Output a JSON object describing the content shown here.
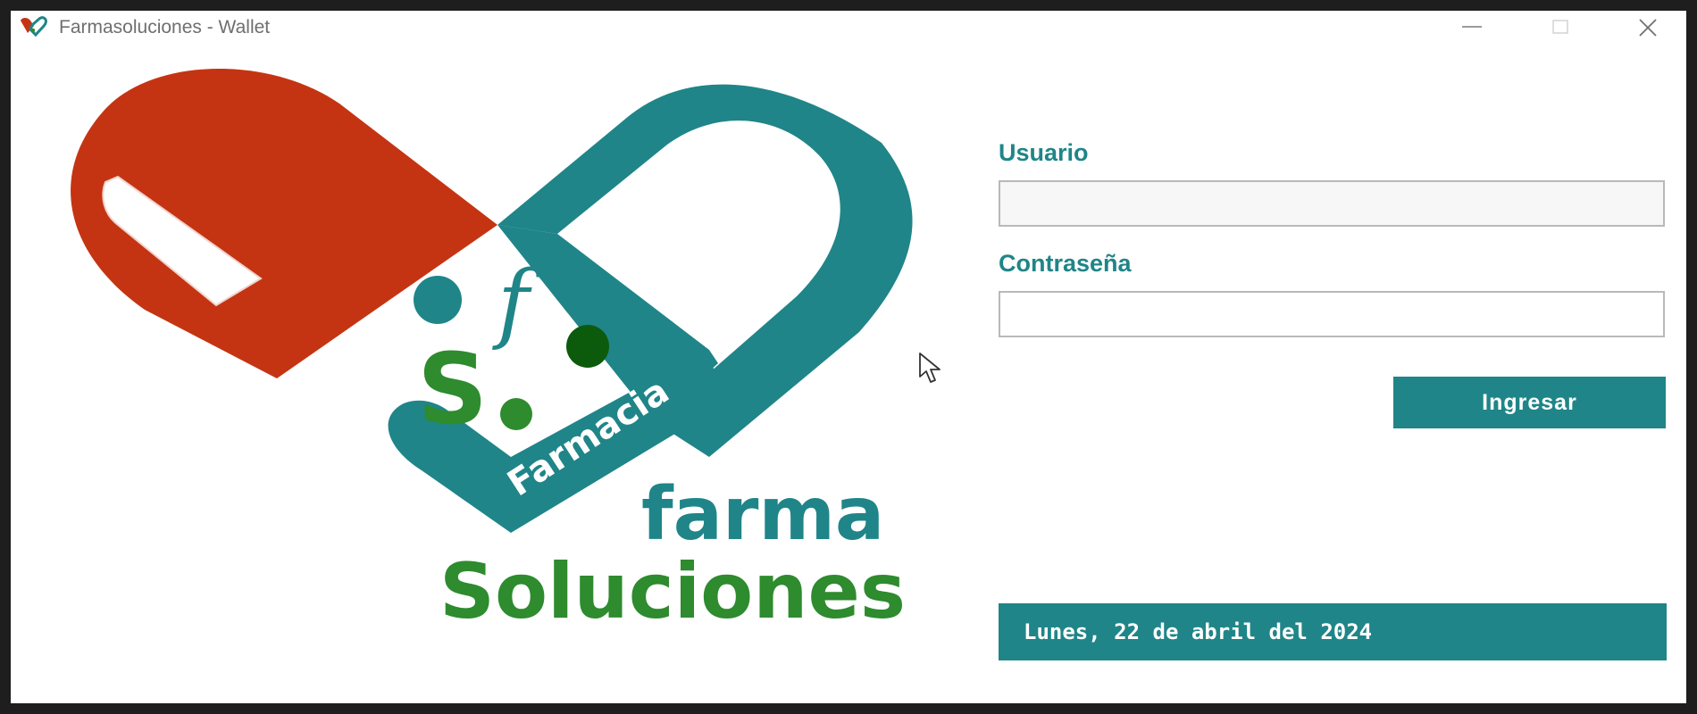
{
  "window": {
    "title": "Farmasoluciones - Wallet"
  },
  "logo": {
    "circle_text": "Farmacia",
    "brand_line1": "farma",
    "brand_line2": "Soluciones",
    "colors": {
      "red": "#c53412",
      "teal": "#1f8588",
      "green": "#2e8b2e",
      "dark_green": "#0c5a0c"
    }
  },
  "form": {
    "user_label": "Usuario",
    "user_value": "",
    "pass_label": "Contraseña",
    "pass_value": "",
    "submit_label": "Ingresar"
  },
  "status": {
    "date_text": "Lunes, 22 de abril del 2024"
  },
  "icons": {
    "app": "pill-heart-icon",
    "minimize": "minimize-icon",
    "maximize": "maximize-icon",
    "close": "close-icon",
    "cursor": "mouse-pointer-icon"
  }
}
